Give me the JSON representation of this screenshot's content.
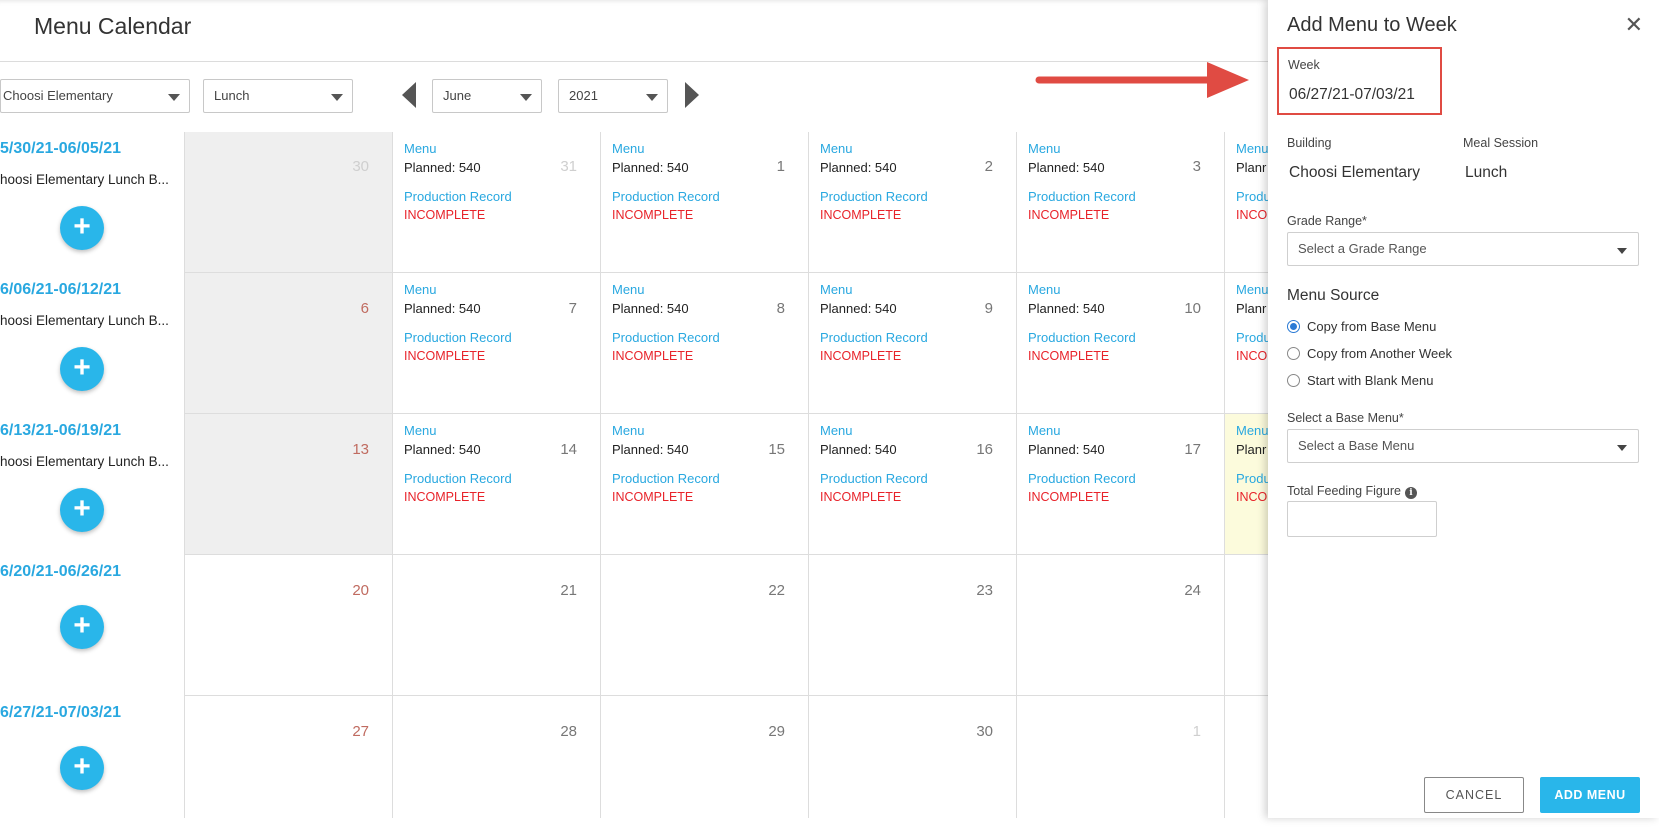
{
  "header": {
    "title": "Menu Calendar"
  },
  "filters": {
    "building": "Choosi Elementary",
    "meal_session": "Lunch",
    "month": "June",
    "year": "2021"
  },
  "weeks": [
    {
      "label": "5/30/21-06/05/21",
      "desc": "hoosi Elementary Lunch B..."
    },
    {
      "label": "6/06/21-06/12/21",
      "desc": "hoosi Elementary Lunch B..."
    },
    {
      "label": "6/13/21-06/19/21",
      "desc": "hoosi Elementary Lunch B..."
    },
    {
      "label": "6/20/21-06/26/21",
      "desc": ""
    },
    {
      "label": "6/27/21-07/03/21",
      "desc": ""
    }
  ],
  "add_symbol": "+",
  "cell_text": {
    "menu": "Menu",
    "planned": "Planned: 540",
    "production": "Production Record",
    "status": "INCOMPLETE",
    "planned_partial": "Planr",
    "production_partial": "Produ",
    "status_partial": "INCO"
  },
  "calendar": [
    {
      "days": [
        "30",
        "31",
        "1",
        "2",
        "3",
        ""
      ]
    },
    {
      "days": [
        "6",
        "7",
        "8",
        "9",
        "10",
        ""
      ]
    },
    {
      "days": [
        "13",
        "14",
        "15",
        "16",
        "17",
        ""
      ]
    },
    {
      "days": [
        "20",
        "21",
        "22",
        "23",
        "24",
        ""
      ]
    },
    {
      "days": [
        "27",
        "28",
        "29",
        "30",
        "1",
        ""
      ]
    }
  ],
  "panel": {
    "title": "Add Menu to Week",
    "close": "✕",
    "week_label": "Week",
    "week_value": "06/27/21-07/03/21",
    "building_label": "Building",
    "building_value": "Choosi Elementary",
    "meal_label": "Meal Session",
    "meal_value": "Lunch",
    "grade_label": "Grade Range*",
    "grade_placeholder": "Select a Grade Range",
    "menu_source_title": "Menu Source",
    "options": [
      "Copy from Base Menu",
      "Copy from Another Week",
      "Start with Blank Menu"
    ],
    "selected_option": 0,
    "base_menu_label": "Select a Base Menu*",
    "base_menu_placeholder": "Select a Base Menu",
    "feeding_label": "Total Feeding Figure",
    "info_symbol": "i",
    "cancel_label": "CANCEL",
    "add_label": "ADD MENU"
  },
  "colors": {
    "accent": "#29b6ea",
    "link": "#29a8e0",
    "error": "#e8232a",
    "highlight": "#e04b43"
  }
}
